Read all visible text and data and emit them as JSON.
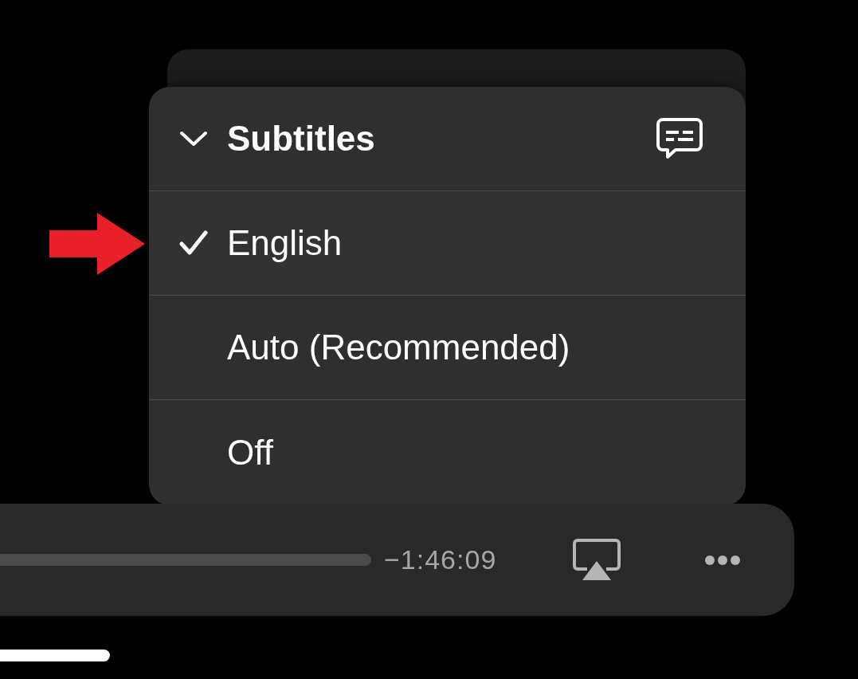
{
  "menu": {
    "title": "Subtitles",
    "expanded": true,
    "items": [
      {
        "label": "English",
        "selected": true
      },
      {
        "label": "Auto (Recommended)",
        "selected": false
      },
      {
        "label": "Off",
        "selected": false
      }
    ]
  },
  "player": {
    "remaining_time": "−1:46:09"
  }
}
